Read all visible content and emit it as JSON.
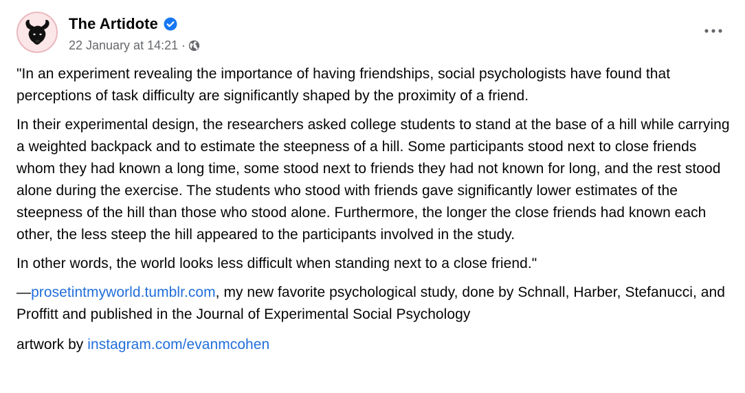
{
  "post": {
    "page_name": "The Artidote",
    "timestamp": "22 January at 14:21",
    "separator": "·",
    "icons": {
      "avatar": "bull-logo",
      "verified": "verified-badge-icon",
      "audience": "globe-icon",
      "more": "more-options-icon"
    },
    "colors": {
      "link": "#216fdb",
      "verified": "#1877f2",
      "secondary_text": "#65676b"
    },
    "paragraphs": {
      "p1": "\"In an experiment revealing the importance of having friendships, social psychologists have found that perceptions of task difficulty are significantly shaped by the proximity of a friend.",
      "p2": "In their experimental design, the researchers asked college students to stand at the base of a hill while carrying a weighted backpack and to estimate the steepness of a hill. Some participants stood next to close friends whom they had known a long time, some stood next to friends they had not known for long, and the rest stood alone during the exercise. The students who stood with friends gave significantly lower estimates of the steepness of the hill than those who stood alone. Furthermore, the longer the close friends had known each other, the less steep the hill appeared to the participants involved in the study.",
      "p3": "In other words, the world looks less difficult when standing next to a close friend.\"",
      "p4_prefix": "—",
      "p4_link": "prosetintmyworld.tumblr.com",
      "p4_rest": ", my new favorite psychological study, done by Schnall, Harber, Stefanucci, and Proffitt and published in the Journal of Experimental Social Psychology",
      "p5_prefix": "artwork by ",
      "p5_link": "instagram.com/evanmcohen"
    }
  }
}
